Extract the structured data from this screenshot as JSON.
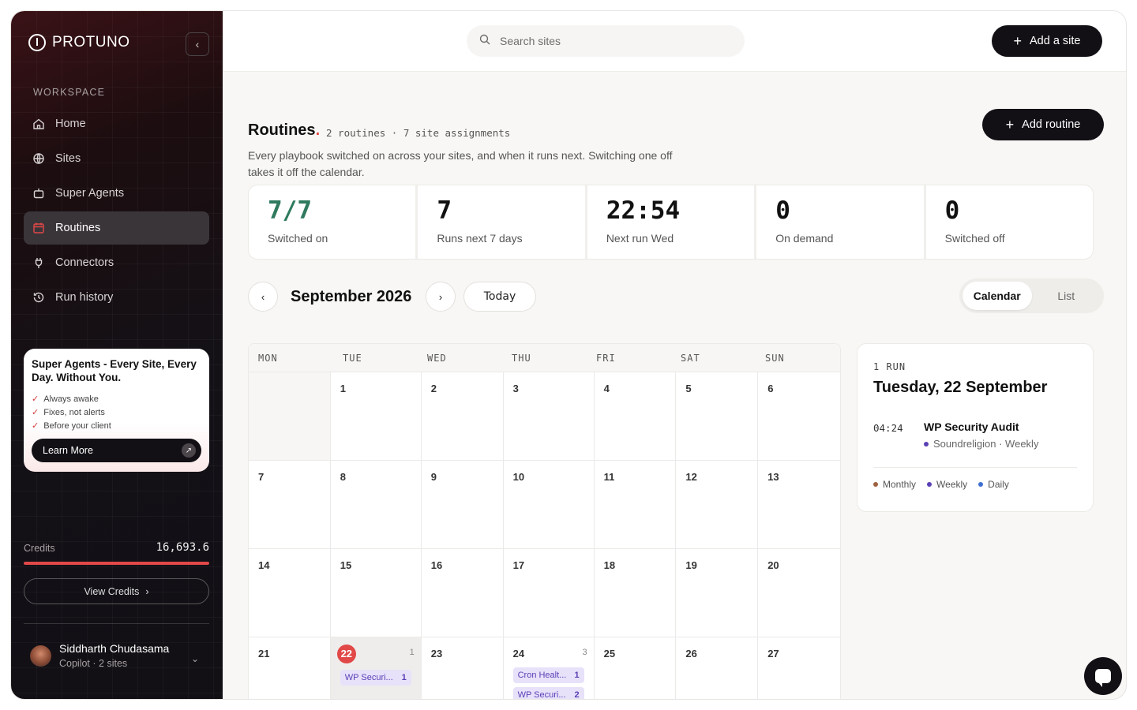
{
  "brand": {
    "name": "PROTUNO"
  },
  "sidebar": {
    "section_label": "WORKSPACE",
    "items": [
      {
        "label": "Home",
        "icon": "home-icon"
      },
      {
        "label": "Sites",
        "icon": "globe-icon"
      },
      {
        "label": "Super Agents",
        "icon": "robot-icon"
      },
      {
        "label": "Routines",
        "icon": "calendar-icon",
        "active": true
      },
      {
        "label": "Connectors",
        "icon": "plug-icon"
      },
      {
        "label": "Run history",
        "icon": "history-icon"
      }
    ],
    "promo": {
      "title": "Super Agents - Every Site, Every Day. Without You.",
      "bullets": [
        "Always awake",
        "Fixes, not alerts",
        "Before your client"
      ],
      "cta": "Learn More"
    },
    "credits": {
      "label": "Credits",
      "value": "16,693.6",
      "fill_fraction": 1.0,
      "button": "View Credits"
    },
    "user": {
      "name": "Siddharth Chudasama",
      "subtitle": "Copilot · 2 sites"
    }
  },
  "topbar": {
    "search_placeholder": "Search sites",
    "add_site": "Add a site"
  },
  "page": {
    "title": "Routines",
    "meta": "2 routines · 7 site assignments",
    "description": "Every playbook switched on across your sites, and when it runs next. Switching one off takes it off the calendar.",
    "add_routine": "Add routine"
  },
  "stats": [
    {
      "value": "7/7",
      "label": "Switched on"
    },
    {
      "value": "7",
      "label": "Runs next 7 days"
    },
    {
      "value": "22:54",
      "label": "Next run Wed"
    },
    {
      "value": "0",
      "label": "On demand"
    },
    {
      "value": "0",
      "label": "Switched off"
    }
  ],
  "calendar": {
    "month": "September 2026",
    "today_label": "Today",
    "views": [
      "Calendar",
      "List"
    ],
    "active_view": "Calendar",
    "weekdays": [
      "MON",
      "TUE",
      "WED",
      "THU",
      "FRI",
      "SAT",
      "SUN"
    ],
    "selected_day": "22",
    "weeks": [
      [
        "",
        "1",
        "2",
        "3",
        "4",
        "5",
        "6"
      ],
      [
        "7",
        "8",
        "9",
        "10",
        "11",
        "12",
        "13"
      ],
      [
        "14",
        "15",
        "16",
        "17",
        "18",
        "19",
        "20"
      ],
      [
        "21",
        "22",
        "23",
        "24",
        "25",
        "26",
        "27"
      ]
    ],
    "events": {
      "22": {
        "count": "1",
        "items": [
          {
            "label": "WP Securi...",
            "n": "1"
          }
        ]
      },
      "24": {
        "count": "3",
        "items": [
          {
            "label": "Cron Healt...",
            "n": "1"
          },
          {
            "label": "WP Securi...",
            "n": "2"
          }
        ]
      }
    }
  },
  "detail": {
    "kicker": "1 RUN",
    "date": "Tuesday, 22 September",
    "runs": [
      {
        "time": "04:24",
        "name": "WP Security Audit",
        "site": "Soundreligion · Weekly"
      }
    ],
    "legend": [
      {
        "label": "Monthly",
        "color": "#a0623f"
      },
      {
        "label": "Weekly",
        "color": "#5a3fb5"
      },
      {
        "label": "Daily",
        "color": "#3f6fd0"
      }
    ]
  },
  "colors": {
    "accent": "#e24848",
    "dark": "#121015",
    "green": "#2f7a5e",
    "event_bg": "#e7e1fa",
    "event_fg": "#5a3fb5"
  }
}
